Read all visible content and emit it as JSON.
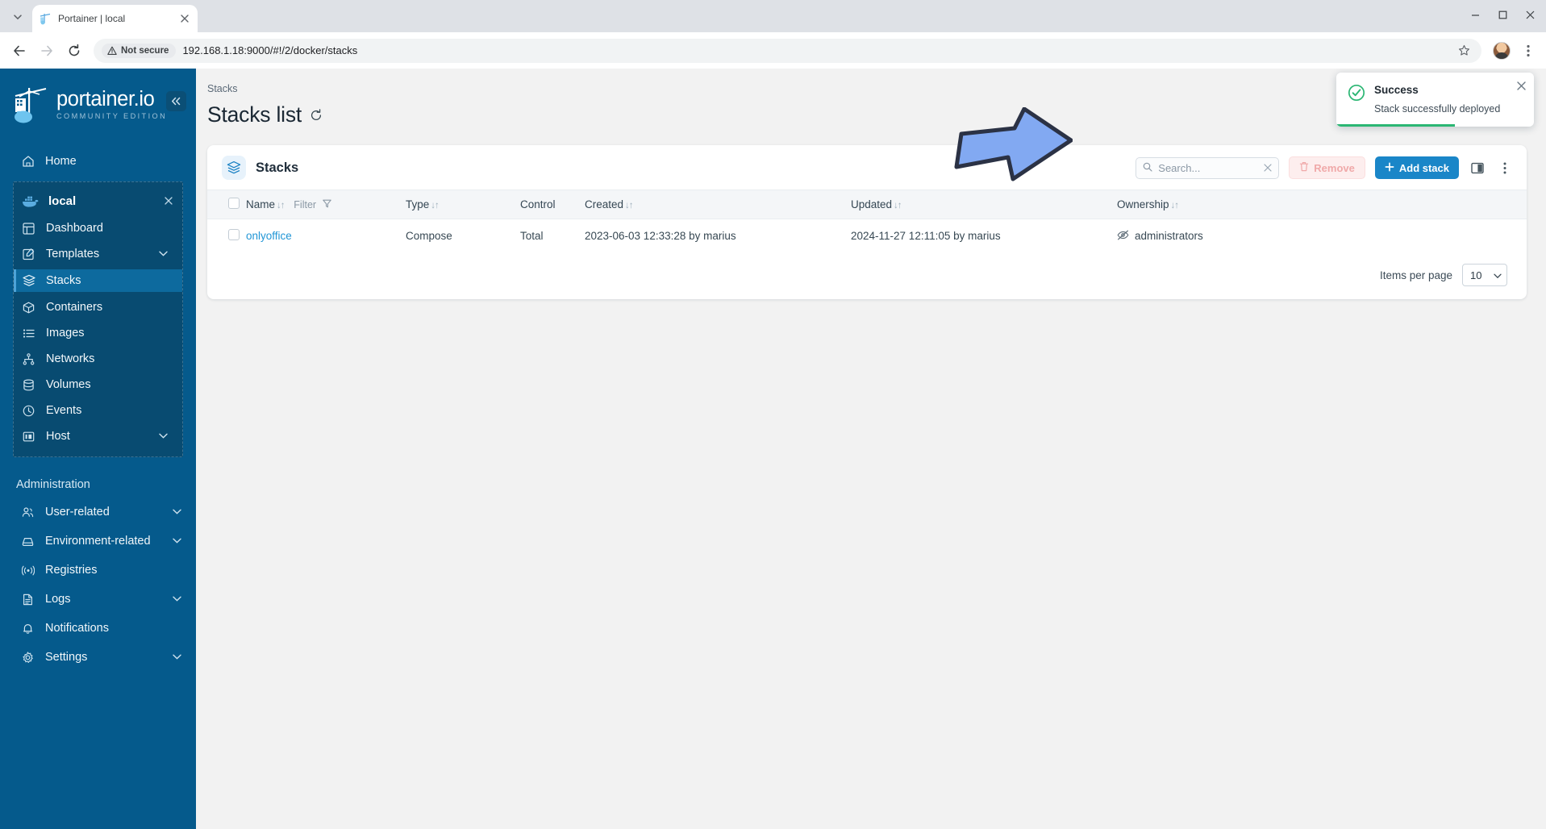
{
  "browser": {
    "tab": {
      "title": "Portainer | local",
      "favicon": "portainer-favicon"
    },
    "tab_list_icon": "chevron-down-icon",
    "close_tab_icon": "close-icon",
    "back_icon": "arrow-left-icon",
    "forward_icon": "arrow-right-icon",
    "reload_icon": "reload-icon",
    "security_label": "Not secure",
    "security_icon": "warning-triangle-icon",
    "url": "192.168.1.18:9000/#!/2/docker/stacks",
    "bookmark_icon": "star-icon",
    "profile_icon": "avatar",
    "menu_icon": "kebab-menu-icon",
    "minimize_icon": "minimize-icon",
    "maximize_icon": "maximize-icon",
    "window_close_icon": "close-icon"
  },
  "sidebar": {
    "logo_name": "portainer.io",
    "logo_sub": "COMMUNITY EDITION",
    "collapse_icon": "double-chevron-left-icon",
    "home": {
      "label": "Home",
      "icon": "home-icon"
    },
    "environment": {
      "label": "local",
      "icon": "docker-icon",
      "close_icon": "close-icon"
    },
    "env_items": [
      {
        "label": "Dashboard",
        "icon": "dashboard-icon",
        "chevron": "",
        "active": false
      },
      {
        "label": "Templates",
        "icon": "templates-icon",
        "chevron": "chevron-down-icon",
        "active": false
      },
      {
        "label": "Stacks",
        "icon": "stacks-icon",
        "chevron": "",
        "active": true
      },
      {
        "label": "Containers",
        "icon": "containers-icon",
        "chevron": "",
        "active": false
      },
      {
        "label": "Images",
        "icon": "images-icon",
        "chevron": "",
        "active": false
      },
      {
        "label": "Networks",
        "icon": "networks-icon",
        "chevron": "",
        "active": false
      },
      {
        "label": "Volumes",
        "icon": "volumes-icon",
        "chevron": "",
        "active": false
      },
      {
        "label": "Events",
        "icon": "events-icon",
        "chevron": "",
        "active": false
      },
      {
        "label": "Host",
        "icon": "host-icon",
        "chevron": "chevron-down-icon",
        "active": false
      }
    ],
    "admin_title": "Administration",
    "admin_items": [
      {
        "label": "User-related",
        "icon": "users-icon",
        "chevron": "chevron-down-icon"
      },
      {
        "label": "Environment-related",
        "icon": "environment-icon",
        "chevron": "chevron-down-icon"
      },
      {
        "label": "Registries",
        "icon": "registries-icon",
        "chevron": ""
      },
      {
        "label": "Logs",
        "icon": "logs-icon",
        "chevron": "chevron-down-icon"
      },
      {
        "label": "Notifications",
        "icon": "bell-icon",
        "chevron": ""
      },
      {
        "label": "Settings",
        "icon": "gear-icon",
        "chevron": "chevron-down-icon"
      }
    ]
  },
  "main": {
    "breadcrumb": "Stacks",
    "page_title": "Stacks list",
    "refresh_icon": "refresh-icon",
    "card": {
      "icon": "stacks-icon",
      "title": "Stacks",
      "search_placeholder": "Search...",
      "search_value": "",
      "search_icon": "search-icon",
      "search_clear_icon": "close-icon",
      "remove_label": "Remove",
      "remove_icon": "trash-icon",
      "add_label": "Add stack",
      "add_icon": "plus-icon",
      "columns_icon": "columns-icon",
      "more_icon": "kebab-menu-icon"
    },
    "table": {
      "columns": [
        {
          "label": "Name",
          "sortable": true,
          "filter": "Filter",
          "filter_icon": "funnel-icon"
        },
        {
          "label": "Type",
          "sortable": true
        },
        {
          "label": "Control",
          "sortable": false
        },
        {
          "label": "Created",
          "sortable": true
        },
        {
          "label": "Updated",
          "sortable": true
        },
        {
          "label": "Ownership",
          "sortable": true
        }
      ],
      "rows": [
        {
          "name": "onlyoffice",
          "type": "Compose",
          "control": "Total",
          "created": "2023-06-03 12:33:28 by marius",
          "updated": "2024-11-27 12:11:05 by marius",
          "ownership": "administrators",
          "ownership_icon": "eye-off-icon"
        }
      ]
    },
    "footer": {
      "items_per_page_label": "Items per page",
      "items_per_page_value": "10",
      "chevron_icon": "chevron-down-icon"
    }
  },
  "toast": {
    "title": "Success",
    "message": "Stack successfully deployed",
    "icon": "check-circle-icon",
    "close_icon": "close-icon"
  },
  "annotation": {
    "arrow_icon": "arrow-right-annotation",
    "color": "#82a9f2"
  },
  "colors": {
    "sidebar": "#055a8c",
    "accent": "#1a86c8",
    "link": "#2196d6",
    "success": "#2bb673",
    "danger": "#f0a9a9"
  }
}
